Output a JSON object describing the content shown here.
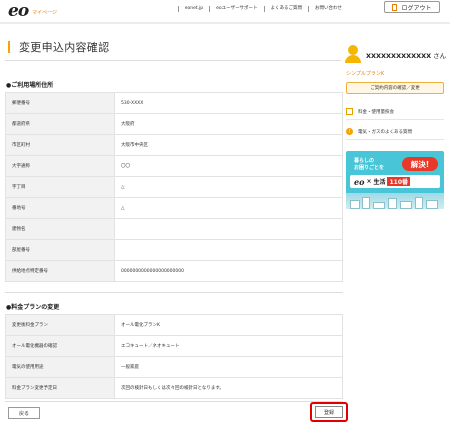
{
  "header": {
    "logo_text": "eo",
    "logo_sub": "マイページ",
    "nav": [
      "eonet.jp",
      "eoユーザーサポート",
      "よくあるご質問",
      "お問い合わせ"
    ],
    "logout_label": "ログアウト"
  },
  "page": {
    "title": "変更申込内容確認"
  },
  "section1": {
    "heading": "●ご利用場所住所",
    "rows": [
      {
        "label": "郵便番号",
        "value": "530-XXXX"
      },
      {
        "label": "都道府県",
        "value": "大阪府"
      },
      {
        "label": "市区町村",
        "value": "大阪市中央区"
      },
      {
        "label": "大字通称",
        "value": "〇〇"
      },
      {
        "label": "字丁目",
        "value": "△"
      },
      {
        "label": "番地号",
        "value": "△"
      },
      {
        "label": "建物名",
        "value": ""
      },
      {
        "label": "部屋番号",
        "value": ""
      },
      {
        "label": "供給地点特定番号",
        "value": "0000000000000000000000"
      }
    ]
  },
  "section2": {
    "heading": "●料金プランの変更",
    "rows": [
      {
        "label": "変更後料金プラン",
        "value": "オール電化プランK"
      },
      {
        "label": "オール電化機器の確認",
        "value": "エコキュート／ネオキュート"
      },
      {
        "label": "電気の使用用途",
        "value": "一般家庭"
      },
      {
        "label": "料金プラン変更予定日",
        "value": "次回の検針日もしくは次々回の検針日となります。"
      }
    ]
  },
  "buttons": {
    "back": "戻る",
    "register": "登録"
  },
  "sidebar": {
    "user_name": "XXXXXXXXXXXXX",
    "user_suffix": "さん",
    "plan": "シンプルプランK",
    "plan_button": "ご契約内容の確認／変更",
    "links": [
      "料金・使用量照会",
      "電気・ガスのよくある質問"
    ]
  },
  "banner": {
    "line1": "暮らしの",
    "line2": "お困りごとを",
    "bubble": "解決!",
    "brand": "eo",
    "brand_join": "×",
    "service": "生活",
    "service_num": "110番"
  },
  "colors": {
    "accent": "#f4a300",
    "highlight_border": "#e00000",
    "banner_bg": "#48c6d8"
  }
}
